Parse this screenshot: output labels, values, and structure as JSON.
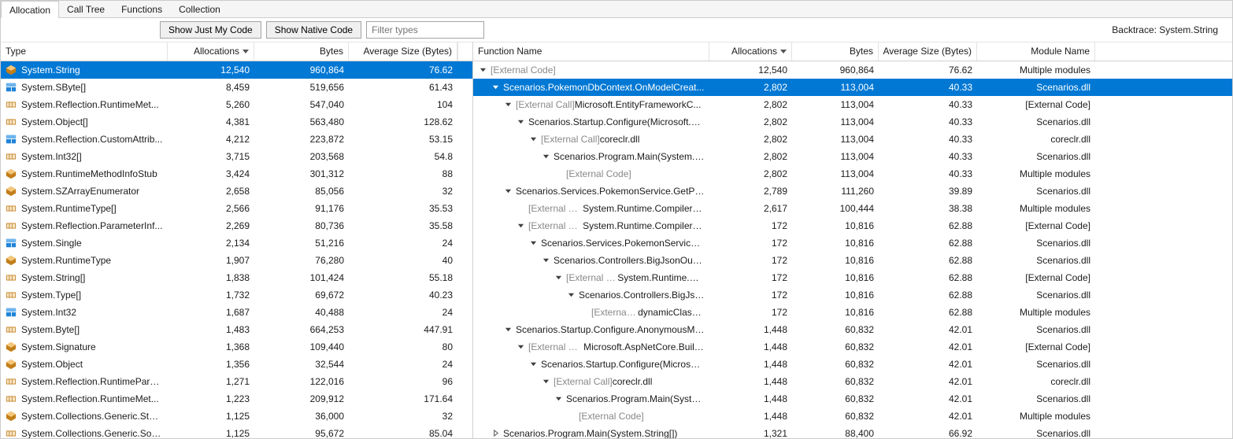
{
  "tabs": [
    "Allocation",
    "Call Tree",
    "Functions",
    "Collection"
  ],
  "toolbar": {
    "show_just_my_code": "Show Just My Code",
    "show_native_code": "Show Native Code",
    "filter_placeholder": "Filter types",
    "backtrace_label": "Backtrace: ",
    "backtrace_value": "System.String"
  },
  "left": {
    "headers": {
      "type": "Type",
      "allocations": "Allocations",
      "bytes": "Bytes",
      "avg": "Average Size (Bytes)"
    },
    "rows": [
      {
        "icon": "class",
        "type": "System.String",
        "alloc": "12,540",
        "bytes": "960,864",
        "avg": "76.62",
        "selected": true
      },
      {
        "icon": "struct",
        "type": "System.SByte[]",
        "alloc": "8,459",
        "bytes": "519,656",
        "avg": "61.43"
      },
      {
        "icon": "array",
        "type": "System.Reflection.RuntimeMet...",
        "alloc": "5,260",
        "bytes": "547,040",
        "avg": "104"
      },
      {
        "icon": "array",
        "type": "System.Object[]",
        "alloc": "4,381",
        "bytes": "563,480",
        "avg": "128.62"
      },
      {
        "icon": "struct",
        "type": "System.Reflection.CustomAttrib...",
        "alloc": "4,212",
        "bytes": "223,872",
        "avg": "53.15"
      },
      {
        "icon": "array",
        "type": "System.Int32[]",
        "alloc": "3,715",
        "bytes": "203,568",
        "avg": "54.8"
      },
      {
        "icon": "class",
        "type": "System.RuntimeMethodInfoStub",
        "alloc": "3,424",
        "bytes": "301,312",
        "avg": "88"
      },
      {
        "icon": "class",
        "type": "System.SZArrayEnumerator",
        "alloc": "2,658",
        "bytes": "85,056",
        "avg": "32"
      },
      {
        "icon": "array",
        "type": "System.RuntimeType[]",
        "alloc": "2,566",
        "bytes": "91,176",
        "avg": "35.53"
      },
      {
        "icon": "array",
        "type": "System.Reflection.ParameterInf...",
        "alloc": "2,269",
        "bytes": "80,736",
        "avg": "35.58"
      },
      {
        "icon": "struct",
        "type": "System.Single",
        "alloc": "2,134",
        "bytes": "51,216",
        "avg": "24"
      },
      {
        "icon": "class",
        "type": "System.RuntimeType",
        "alloc": "1,907",
        "bytes": "76,280",
        "avg": "40"
      },
      {
        "icon": "array",
        "type": "System.String[]",
        "alloc": "1,838",
        "bytes": "101,424",
        "avg": "55.18"
      },
      {
        "icon": "array",
        "type": "System.Type[]",
        "alloc": "1,732",
        "bytes": "69,672",
        "avg": "40.23"
      },
      {
        "icon": "struct",
        "type": "System.Int32",
        "alloc": "1,687",
        "bytes": "40,488",
        "avg": "24"
      },
      {
        "icon": "array",
        "type": "System.Byte[]",
        "alloc": "1,483",
        "bytes": "664,253",
        "avg": "447.91"
      },
      {
        "icon": "class",
        "type": "System.Signature",
        "alloc": "1,368",
        "bytes": "109,440",
        "avg": "80"
      },
      {
        "icon": "class",
        "type": "System.Object",
        "alloc": "1,356",
        "bytes": "32,544",
        "avg": "24"
      },
      {
        "icon": "array",
        "type": "System.Reflection.RuntimePara...",
        "alloc": "1,271",
        "bytes": "122,016",
        "avg": "96"
      },
      {
        "icon": "array",
        "type": "System.Reflection.RuntimeMet...",
        "alloc": "1,223",
        "bytes": "209,912",
        "avg": "171.64"
      },
      {
        "icon": "class",
        "type": "System.Collections.Generic.Stac...",
        "alloc": "1,125",
        "bytes": "36,000",
        "avg": "32"
      },
      {
        "icon": "array",
        "type": "System.Collections.Generic.Sort...",
        "alloc": "1,125",
        "bytes": "95,672",
        "avg": "85.04"
      }
    ]
  },
  "right": {
    "headers": {
      "fn": "Function Name",
      "allocations": "Allocations",
      "bytes": "Bytes",
      "avg": "Average Size (Bytes)",
      "module": "Module Name"
    },
    "rows": [
      {
        "depth": 0,
        "exp": "open",
        "external": true,
        "text": "[External Code]",
        "alloc": "12,540",
        "bytes": "960,864",
        "avg": "76.62",
        "module": "Multiple modules"
      },
      {
        "depth": 1,
        "exp": "open",
        "external": false,
        "text": "Scenarios.PokemonDbContext.OnModelCreat...",
        "alloc": "2,802",
        "bytes": "113,004",
        "avg": "40.33",
        "module": "Scenarios.dll",
        "selected": true
      },
      {
        "depth": 2,
        "exp": "open",
        "external": true,
        "prefix": "[External Call] ",
        "text": "Microsoft.EntityFrameworkC...",
        "alloc": "2,802",
        "bytes": "113,004",
        "avg": "40.33",
        "module": "[External Code]"
      },
      {
        "depth": 3,
        "exp": "open",
        "external": false,
        "text": "Scenarios.Startup.Configure(Microsoft.As...",
        "alloc": "2,802",
        "bytes": "113,004",
        "avg": "40.33",
        "module": "Scenarios.dll"
      },
      {
        "depth": 4,
        "exp": "open",
        "external": true,
        "prefix": "[External Call] ",
        "text": "coreclr.dll",
        "alloc": "2,802",
        "bytes": "113,004",
        "avg": "40.33",
        "module": "coreclr.dll"
      },
      {
        "depth": 5,
        "exp": "open",
        "external": false,
        "text": "Scenarios.Program.Main(System.Stri...",
        "alloc": "2,802",
        "bytes": "113,004",
        "avg": "40.33",
        "module": "Scenarios.dll"
      },
      {
        "depth": 6,
        "exp": "none",
        "external": true,
        "text": "[External Code]",
        "alloc": "2,802",
        "bytes": "113,004",
        "avg": "40.33",
        "module": "Multiple modules"
      },
      {
        "depth": 2,
        "exp": "open",
        "external": false,
        "text": "Scenarios.Services.PokemonService.GetPoke...",
        "alloc": "2,789",
        "bytes": "111,260",
        "avg": "39.89",
        "module": "Scenarios.dll"
      },
      {
        "depth": 3,
        "exp": "none",
        "external": true,
        "prefix": "[External Call] ",
        "text": "System.Runtime.CompilerSer...",
        "alloc": "2,617",
        "bytes": "100,444",
        "avg": "38.38",
        "module": "Multiple modules"
      },
      {
        "depth": 3,
        "exp": "open",
        "external": true,
        "prefix": "[External Call] ",
        "text": "System.Runtime.CompilerSer...",
        "alloc": "172",
        "bytes": "10,816",
        "avg": "62.88",
        "module": "[External Code]"
      },
      {
        "depth": 4,
        "exp": "open",
        "external": false,
        "text": "Scenarios.Services.PokemonService.GetP...",
        "alloc": "172",
        "bytes": "10,816",
        "avg": "62.88",
        "module": "Scenarios.dll"
      },
      {
        "depth": 5,
        "exp": "open",
        "external": false,
        "text": "Scenarios.Controllers.BigJsonOutputC...",
        "alloc": "172",
        "bytes": "10,816",
        "avg": "62.88",
        "module": "Scenarios.dll"
      },
      {
        "depth": 6,
        "exp": "open",
        "external": true,
        "prefix": "[External Call] ",
        "text": "System.Runtime.Com...",
        "alloc": "172",
        "bytes": "10,816",
        "avg": "62.88",
        "module": "[External Code]"
      },
      {
        "depth": 7,
        "exp": "open",
        "external": false,
        "text": "Scenarios.Controllers.BigJsonOutp...",
        "alloc": "172",
        "bytes": "10,816",
        "avg": "62.88",
        "module": "Scenarios.dll"
      },
      {
        "depth": 8,
        "exp": "none",
        "external": true,
        "prefix": "[External Call] ",
        "text": "dynamicClass.lam...",
        "alloc": "172",
        "bytes": "10,816",
        "avg": "62.88",
        "module": "Multiple modules"
      },
      {
        "depth": 2,
        "exp": "open",
        "external": false,
        "text": "Scenarios.Startup.Configure.AnonymousMeth...",
        "alloc": "1,448",
        "bytes": "60,832",
        "avg": "42.01",
        "module": "Scenarios.dll"
      },
      {
        "depth": 3,
        "exp": "open",
        "external": true,
        "prefix": "[External Call] ",
        "text": "Microsoft.AspNetCore.Builde...",
        "alloc": "1,448",
        "bytes": "60,832",
        "avg": "42.01",
        "module": "[External Code]"
      },
      {
        "depth": 4,
        "exp": "open",
        "external": false,
        "text": "Scenarios.Startup.Configure(Microsoft.As...",
        "alloc": "1,448",
        "bytes": "60,832",
        "avg": "42.01",
        "module": "Scenarios.dll"
      },
      {
        "depth": 5,
        "exp": "open",
        "external": true,
        "prefix": "[External Call] ",
        "text": "coreclr.dll",
        "alloc": "1,448",
        "bytes": "60,832",
        "avg": "42.01",
        "module": "coreclr.dll"
      },
      {
        "depth": 6,
        "exp": "open",
        "external": false,
        "text": "Scenarios.Program.Main(System.Stri...",
        "alloc": "1,448",
        "bytes": "60,832",
        "avg": "42.01",
        "module": "Scenarios.dll"
      },
      {
        "depth": 7,
        "exp": "none",
        "external": true,
        "text": "[External Code]",
        "alloc": "1,448",
        "bytes": "60,832",
        "avg": "42.01",
        "module": "Multiple modules"
      },
      {
        "depth": 1,
        "exp": "closed",
        "external": false,
        "text": "Scenarios.Program.Main(System.String[])",
        "alloc": "1,321",
        "bytes": "88,400",
        "avg": "66.92",
        "module": "Scenarios.dll"
      }
    ]
  },
  "icons": {
    "class": "class-icon",
    "struct": "struct-icon",
    "array": "array-icon"
  },
  "colors": {
    "selection": "#0078d4",
    "external_text": "#888888"
  }
}
